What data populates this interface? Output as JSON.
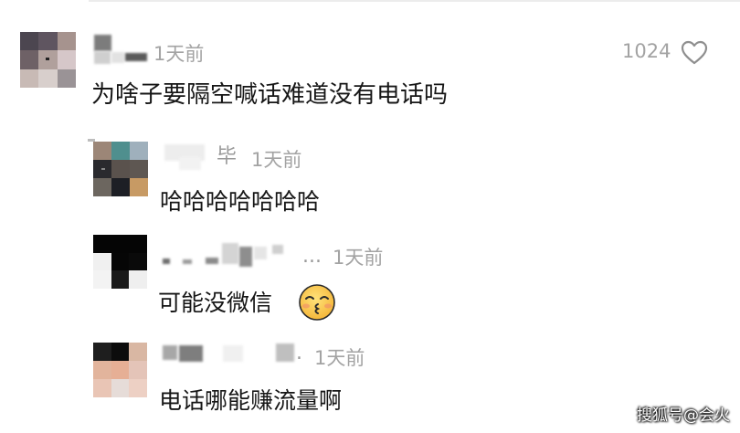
{
  "main_comment": {
    "time": "1天前",
    "text": "为啥子要隔空喊话难道没有电话吗",
    "likes": "1024"
  },
  "replies": [
    {
      "name_tail": "毕",
      "time": "1天前",
      "text": "哈哈哈哈哈哈哈"
    },
    {
      "name_tail": "...",
      "time": "1天前",
      "text": "可能没微信"
    },
    {
      "name_tail": ".",
      "time": "1天前",
      "text": "电话哪能赚流量啊"
    }
  ],
  "watermark": "搜狐号@会火",
  "icons": {
    "like": "heart-outline-icon",
    "emoji": "kissing-face-emoji-icon"
  },
  "colors": {
    "text": "#161616",
    "meta": "#a3a3a3",
    "background": "#ffffff"
  }
}
